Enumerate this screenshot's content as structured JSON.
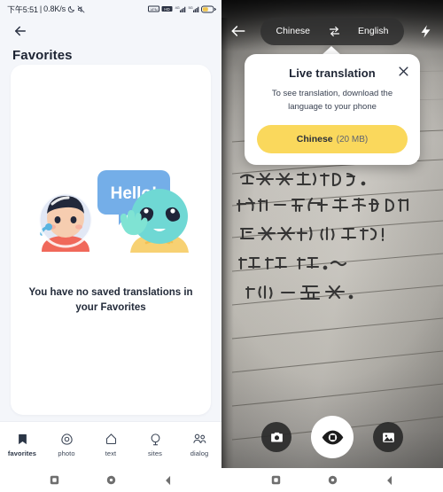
{
  "left": {
    "statusbar": {
      "time": "下午5:51",
      "separator": "|",
      "netspeed": "0.8K/s",
      "icons": [
        "moon-icon",
        "mute-icon",
        "vpn-icon",
        "hd-icon",
        "signal-4g-icon",
        "signal-5g-icon",
        "battery-icon"
      ]
    },
    "back_icon": "back-arrow-icon",
    "title": "Favorites",
    "empty_state": {
      "illustration": "astronaut-alien-hello-illustration",
      "speech_bubble": "Hello!",
      "message": "You have no saved translations in your Favorites"
    },
    "bottom_nav": [
      {
        "id": "favorites",
        "label": "favorites",
        "icon": "bookmark-icon",
        "active": true
      },
      {
        "id": "photo",
        "label": "photo",
        "icon": "camera-icon",
        "active": false
      },
      {
        "id": "text",
        "label": "text",
        "icon": "text-bubble-icon",
        "active": false
      },
      {
        "id": "sites",
        "label": "sites",
        "icon": "globe-icon",
        "active": false
      },
      {
        "id": "dialog",
        "label": "dialog",
        "icon": "people-icon",
        "active": false
      }
    ]
  },
  "right": {
    "topbar": {
      "back_icon": "back-arrow-icon",
      "source_language": "Chinese",
      "swap_icon": "swap-arrows-icon",
      "target_language": "English",
      "flash_icon": "flash-icon"
    },
    "popup": {
      "title": "Live translation",
      "close_icon": "close-icon",
      "description": "To see translation, download the language to your phone",
      "button_language": "Chinese",
      "button_size": "(20 MB)"
    },
    "camera_subject": "handwritten-chinese-note-on-lined-paper",
    "handwritten_lines": [
      "今天天气很好。",
      "我们一起骑车去玩耍吧",
      "真是开心哦!",
      "啦啦啦.~",
      "开心一整天."
    ],
    "controls": [
      {
        "id": "capture-photo",
        "icon": "camera-icon",
        "active": false
      },
      {
        "id": "live-view",
        "icon": "eye-icon",
        "active": true
      },
      {
        "id": "gallery",
        "icon": "image-icon",
        "active": false
      }
    ]
  },
  "android_nav": {
    "buttons": [
      {
        "id": "recents",
        "icon": "square-icon"
      },
      {
        "id": "home",
        "icon": "circle-icon"
      },
      {
        "id": "back",
        "icon": "chevron-left-icon"
      }
    ]
  },
  "colors": {
    "bg": "#f4f6fa",
    "card": "#ffffff",
    "text_dark": "#1d2433",
    "accent_yellow": "#fad85c",
    "alien": "#6fd8d4",
    "astronaut_shirt": "#f0685a",
    "bubble_blue": "#74aee8"
  }
}
